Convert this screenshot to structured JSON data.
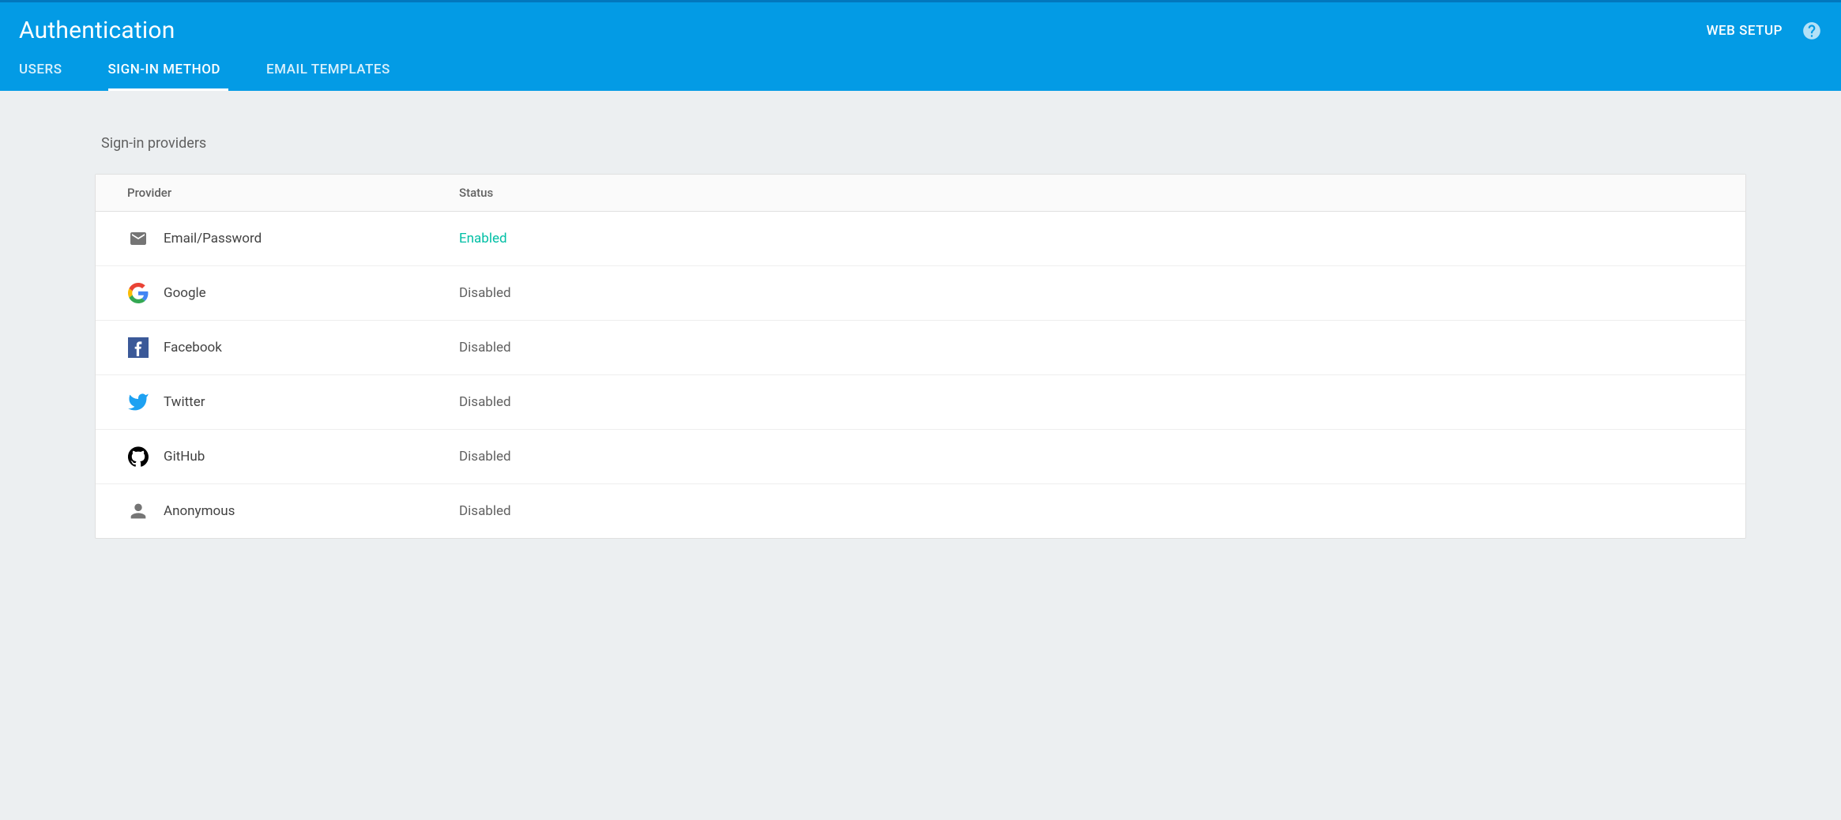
{
  "header": {
    "title": "Authentication",
    "web_setup_label": "WEB SETUP"
  },
  "tabs": [
    {
      "label": "USERS",
      "active": false
    },
    {
      "label": "SIGN-IN METHOD",
      "active": true
    },
    {
      "label": "EMAIL TEMPLATES",
      "active": false
    }
  ],
  "section": {
    "title": "Sign-in providers",
    "columns": {
      "provider": "Provider",
      "status": "Status"
    }
  },
  "providers": [
    {
      "icon": "email-icon",
      "name": "Email/Password",
      "status": "Enabled",
      "enabled": true
    },
    {
      "icon": "google-icon",
      "name": "Google",
      "status": "Disabled",
      "enabled": false
    },
    {
      "icon": "facebook-icon",
      "name": "Facebook",
      "status": "Disabled",
      "enabled": false
    },
    {
      "icon": "twitter-icon",
      "name": "Twitter",
      "status": "Disabled",
      "enabled": false
    },
    {
      "icon": "github-icon",
      "name": "GitHub",
      "status": "Disabled",
      "enabled": false
    },
    {
      "icon": "anonymous-icon",
      "name": "Anonymous",
      "status": "Disabled",
      "enabled": false
    }
  ],
  "colors": {
    "header_bg": "#039be5",
    "enabled": "#00bfa5",
    "disabled_text": "#616161"
  }
}
